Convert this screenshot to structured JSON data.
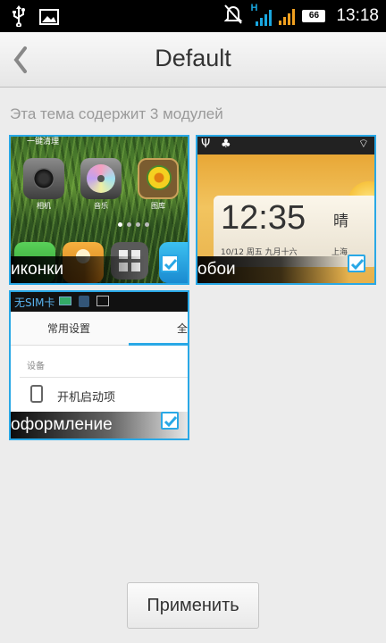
{
  "status_bar": {
    "time": "13:18",
    "battery_level": "66",
    "network_type": "H",
    "icons": [
      "usb-icon",
      "image-icon",
      "muted-icon",
      "signal-icon",
      "signal-icon",
      "battery-icon"
    ]
  },
  "header": {
    "title": "Default",
    "back_icon": "chevron-left-icon"
  },
  "subtitle": "Эта тема содержит 3 модулей",
  "modules": [
    {
      "label": "иконки",
      "checked": true,
      "preview": {
        "top_text": "一键清理",
        "apps": [
          "相机",
          "音乐",
          "图库"
        ]
      }
    },
    {
      "label": "обои",
      "checked": true,
      "preview": {
        "clock_time": "12:35",
        "weather": "晴",
        "date_text": "10/12  周五   九月十六",
        "location_text": "上海"
      }
    },
    {
      "label": "оформление",
      "checked": true,
      "preview": {
        "status_text": "无SIM卡",
        "tabs": [
          "常用设置",
          "全部"
        ],
        "section": "设备",
        "item": "开机启动项"
      }
    }
  ],
  "apply_button": "Применить",
  "colors": {
    "accent": "#29a8e6",
    "background": "#ececec",
    "title_text": "#333333",
    "subtitle_text": "#9a9a9a"
  }
}
